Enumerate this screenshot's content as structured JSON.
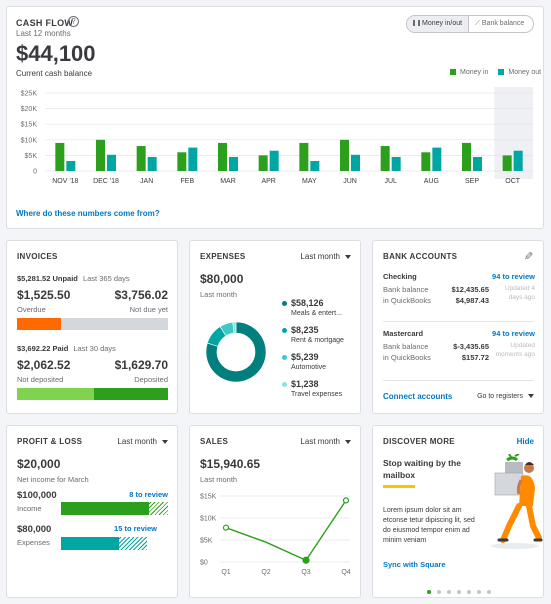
{
  "cashflow": {
    "title": "CASH FLOW",
    "subtitle": "Last 12 months",
    "amount": "$44,100",
    "amount_label": "Current cash balance",
    "toggle": {
      "money": "Money in/out",
      "bank": "Bank balance"
    },
    "footer_link": "Where do these numbers come from?",
    "colors": {
      "in": "#2ca01c",
      "out": "#00a6a4"
    },
    "chart_data": {
      "type": "bar",
      "categories": [
        "NOV '18",
        "DEC '18",
        "JAN",
        "FEB",
        "MAR",
        "APR",
        "MAY",
        "JUN",
        "JUL",
        "AUG",
        "SEP",
        "OCT"
      ],
      "series": [
        {
          "name": "Money in",
          "values": [
            9000,
            10000,
            8000,
            6000,
            9000,
            5000,
            9000,
            10000,
            8000,
            6000,
            9000,
            5000
          ]
        },
        {
          "name": "Money out",
          "values": [
            3200,
            5200,
            4500,
            7500,
            4500,
            6500,
            3200,
            5200,
            4500,
            7500,
            4500,
            6500
          ]
        }
      ],
      "yticks": [
        "$25K",
        "$20K",
        "$15K",
        "$10K",
        "$5K",
        "0"
      ],
      "ylim": [
        0,
        25000
      ],
      "legend_position": "top-right"
    }
  },
  "invoices": {
    "title": "INVOICES",
    "unpaid_amount": "$5,281.52 Unpaid",
    "unpaid_period": "Last 365 days",
    "overdue_value": "$1,525.50",
    "overdue_label": "Overdue",
    "notdue_value": "$3,756.02",
    "notdue_label": "Not due yet",
    "paid_amount": "$3,692.22 Paid",
    "paid_period": "Last 30 days",
    "notdeposited_value": "$2,062.52",
    "notdeposited_label": "Not deposited",
    "deposited_value": "$1,629.70",
    "deposited_label": "Deposited",
    "overdue_fraction": 0.29,
    "notdeposited_fraction": 0.51
  },
  "expenses": {
    "title": "EXPENSES",
    "period": "Last month",
    "amount": "$80,000",
    "amount_label": "Last month",
    "items": [
      {
        "value": "$58,126",
        "label": "Meals & entert...",
        "color": "#007f7e"
      },
      {
        "value": "$8,235",
        "label": "Rent & mortgage",
        "color": "#00a6a4"
      },
      {
        "value": "$5,239",
        "label": "Automotive",
        "color": "#3ec9c7"
      },
      {
        "value": "$1,238",
        "label": "Travel expenses",
        "color": "#8be3e0"
      }
    ],
    "chart_data": {
      "type": "pie",
      "categories": [
        "Meals & entert...",
        "Rent & mortgage",
        "Automotive",
        "Travel expenses"
      ],
      "values": [
        58126,
        8235,
        5239,
        1238
      ]
    }
  },
  "bank": {
    "title": "BANK ACCOUNTS",
    "accounts": [
      {
        "name": "Checking",
        "review": "94 to review",
        "bank_label": "Bank balance",
        "bank_value": "$12,435.65",
        "qb_label": "in QuickBooks",
        "qb_value": "$4,987.43",
        "updated_1": "Updated 4",
        "updated_2": "days ago"
      },
      {
        "name": "Mastercard",
        "review": "94 to review",
        "bank_label": "Bank balance",
        "bank_value": "$-3,435.65",
        "qb_label": "in QuickBooks",
        "qb_value": "$157.72",
        "updated_1": "Updated",
        "updated_2": "moments ago"
      }
    ],
    "connect": "Connect accounts",
    "registers": "Go to registers"
  },
  "pl": {
    "title": "PROFIT & LOSS",
    "period": "Last month",
    "amount": "$20,000",
    "amount_label": "Net income for March",
    "income_value": "$100,000",
    "income_label": "Income",
    "income_review": "8 to review",
    "expenses_value": "$80,000",
    "expenses_label": "Expenses",
    "expenses_review": "15 to review",
    "income_fraction": 0.82,
    "expenses_fraction": 0.68
  },
  "sales": {
    "title": "SALES",
    "period": "Last month",
    "amount": "$15,940.65",
    "amount_label": "Last month",
    "chart_data": {
      "type": "line",
      "categories": [
        "Q1",
        "Q2",
        "Q3",
        "Q4"
      ],
      "values": [
        7800,
        4500,
        400,
        14000
      ],
      "yticks": [
        "$15K",
        "$10K",
        "$5K",
        "$0"
      ],
      "ylim": [
        0,
        15000
      ]
    }
  },
  "discover": {
    "title": "DISCOVER MORE",
    "hide": "Hide",
    "headline": "Stop waiting by the mailbox",
    "body": "Lorem ipsum dolor sit am etconse tetur dipiscing lit, sed do eiusmod tempor enim ad minim veniam",
    "link": "Sync with Square",
    "pages": 7,
    "active_page": 0
  }
}
